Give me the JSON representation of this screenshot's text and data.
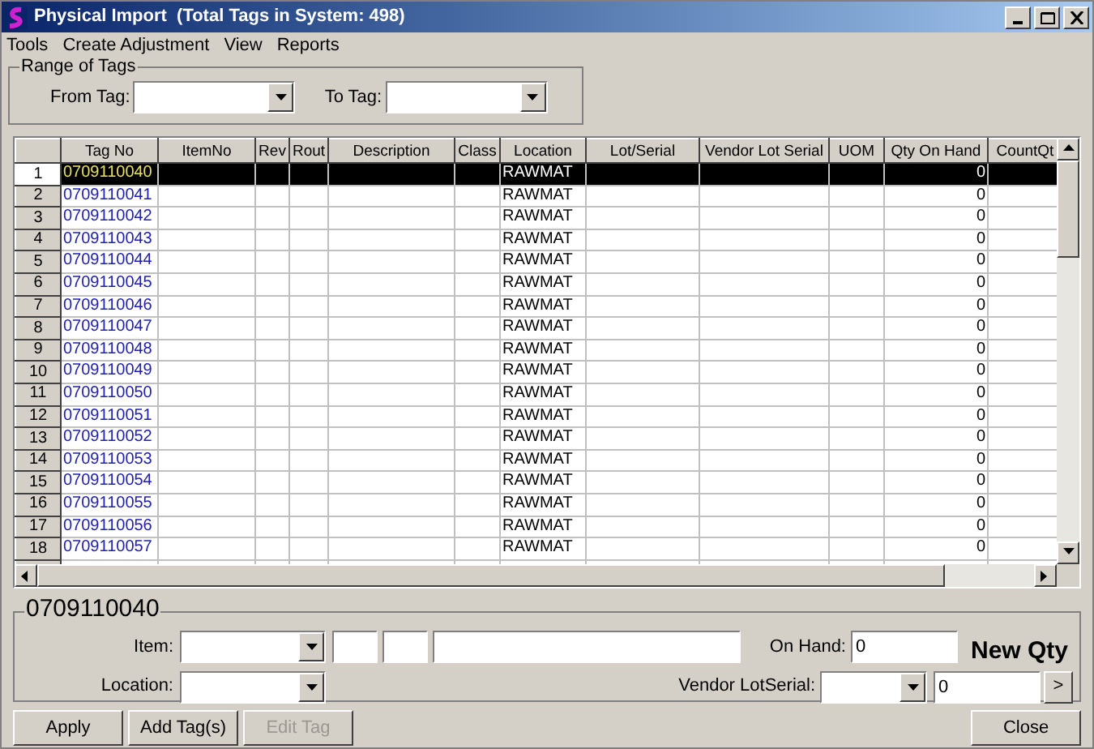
{
  "window": {
    "title": "Physical Import  (Total Tags in System: 498)"
  },
  "menu": [
    "Tools",
    "Create Adjustment",
    "View",
    "Reports"
  ],
  "range": {
    "title": "Range of Tags",
    "from_label": "From Tag:",
    "to_label": "To Tag:"
  },
  "table": {
    "columns": [
      "Tag No",
      "ItemNo",
      "Rev",
      "Rout",
      "Description",
      "Class",
      "Location",
      "Lot/Serial",
      "Vendor Lot Serial",
      "UOM",
      "Qty On Hand",
      "CountQt"
    ],
    "rows": [
      {
        "num": "1",
        "tag": "0709110040",
        "location": "RAWMAT",
        "qty": "0",
        "selected": true
      },
      {
        "num": "2",
        "tag": "0709110041",
        "location": "RAWMAT",
        "qty": "0",
        "selected": false
      },
      {
        "num": "3",
        "tag": "0709110042",
        "location": "RAWMAT",
        "qty": "0",
        "selected": false
      },
      {
        "num": "4",
        "tag": "0709110043",
        "location": "RAWMAT",
        "qty": "0",
        "selected": false
      },
      {
        "num": "5",
        "tag": "0709110044",
        "location": "RAWMAT",
        "qty": "0",
        "selected": false
      },
      {
        "num": "6",
        "tag": "0709110045",
        "location": "RAWMAT",
        "qty": "0",
        "selected": false
      },
      {
        "num": "7",
        "tag": "0709110046",
        "location": "RAWMAT",
        "qty": "0",
        "selected": false
      },
      {
        "num": "8",
        "tag": "0709110047",
        "location": "RAWMAT",
        "qty": "0",
        "selected": false
      },
      {
        "num": "9",
        "tag": "0709110048",
        "location": "RAWMAT",
        "qty": "0",
        "selected": false
      },
      {
        "num": "10",
        "tag": "0709110049",
        "location": "RAWMAT",
        "qty": "0",
        "selected": false
      },
      {
        "num": "11",
        "tag": "0709110050",
        "location": "RAWMAT",
        "qty": "0",
        "selected": false
      },
      {
        "num": "12",
        "tag": "0709110051",
        "location": "RAWMAT",
        "qty": "0",
        "selected": false
      },
      {
        "num": "13",
        "tag": "0709110052",
        "location": "RAWMAT",
        "qty": "0",
        "selected": false
      },
      {
        "num": "14",
        "tag": "0709110053",
        "location": "RAWMAT",
        "qty": "0",
        "selected": false
      },
      {
        "num": "15",
        "tag": "0709110054",
        "location": "RAWMAT",
        "qty": "0",
        "selected": false
      },
      {
        "num": "16",
        "tag": "0709110055",
        "location": "RAWMAT",
        "qty": "0",
        "selected": false
      },
      {
        "num": "17",
        "tag": "0709110056",
        "location": "RAWMAT",
        "qty": "0",
        "selected": false
      },
      {
        "num": "18",
        "tag": "0709110057",
        "location": "RAWMAT",
        "qty": "0",
        "selected": false
      }
    ]
  },
  "detail": {
    "title": "0709110040",
    "item_label": "Item:",
    "location_label": "Location:",
    "on_hand_label": "On Hand:",
    "on_hand": "0",
    "vendor_lot_label": "Vendor LotSerial:",
    "new_qty_label": "New Qty",
    "new_qty": "0",
    "next_button": ">"
  },
  "buttons": [
    {
      "label": "Apply",
      "disabled": false
    },
    {
      "label": "Add Tag(s)",
      "disabled": false
    },
    {
      "label": "Edit Tag",
      "disabled": true
    }
  ],
  "close_button": "Close"
}
